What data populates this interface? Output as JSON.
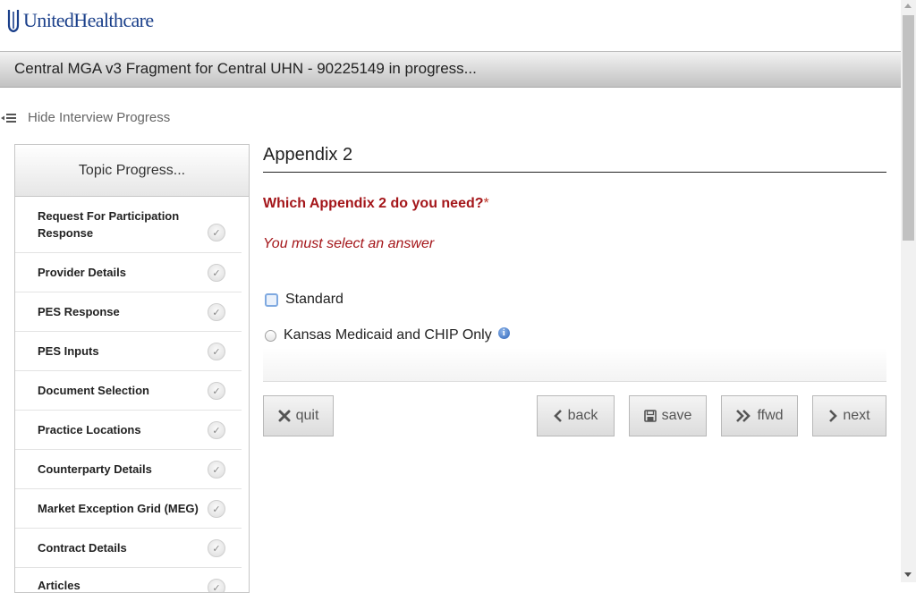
{
  "brand": {
    "name": "UnitedHealthcare",
    "color": "#1a3f8a"
  },
  "title_bar": {
    "title": "Central MGA v3 Fragment for Central UHN - 90225149 in progress..."
  },
  "progress_toggle": {
    "label": "Hide Interview Progress",
    "icon": "collapse-list-icon"
  },
  "sidebar": {
    "heading": "Topic Progress...",
    "topics": [
      {
        "label": "Request For Participation Response",
        "status": "complete"
      },
      {
        "label": "Provider Details",
        "status": "complete"
      },
      {
        "label": "PES Response",
        "status": "complete"
      },
      {
        "label": "PES Inputs",
        "status": "complete"
      },
      {
        "label": "Document Selection",
        "status": "complete"
      },
      {
        "label": "Practice Locations",
        "status": "complete"
      },
      {
        "label": "Counterparty Details",
        "status": "complete"
      },
      {
        "label": "Market Exception Grid (MEG)",
        "status": "complete"
      },
      {
        "label": "Contract Details",
        "status": "complete"
      },
      {
        "label": "Articles",
        "status": "complete"
      }
    ]
  },
  "main": {
    "section_title": "Appendix 2",
    "question": "Which Appendix 2 do you need?",
    "required_marker": "*",
    "error_message": "You must select an answer",
    "options": [
      {
        "label": "Standard",
        "selected": false,
        "focused": true
      },
      {
        "label": "Kansas Medicaid and CHIP Only",
        "selected": false,
        "info": true
      }
    ],
    "error_color": "#a4161a"
  },
  "buttons": {
    "quit": {
      "label": "quit",
      "icon": "close-icon"
    },
    "back": {
      "label": "back",
      "icon": "chevron-left-icon"
    },
    "save": {
      "label": "save",
      "icon": "floppy-disk-icon"
    },
    "ffwd": {
      "label": "ffwd",
      "icon": "double-chevron-right-icon"
    },
    "next": {
      "label": "next",
      "icon": "chevron-right-icon"
    }
  }
}
